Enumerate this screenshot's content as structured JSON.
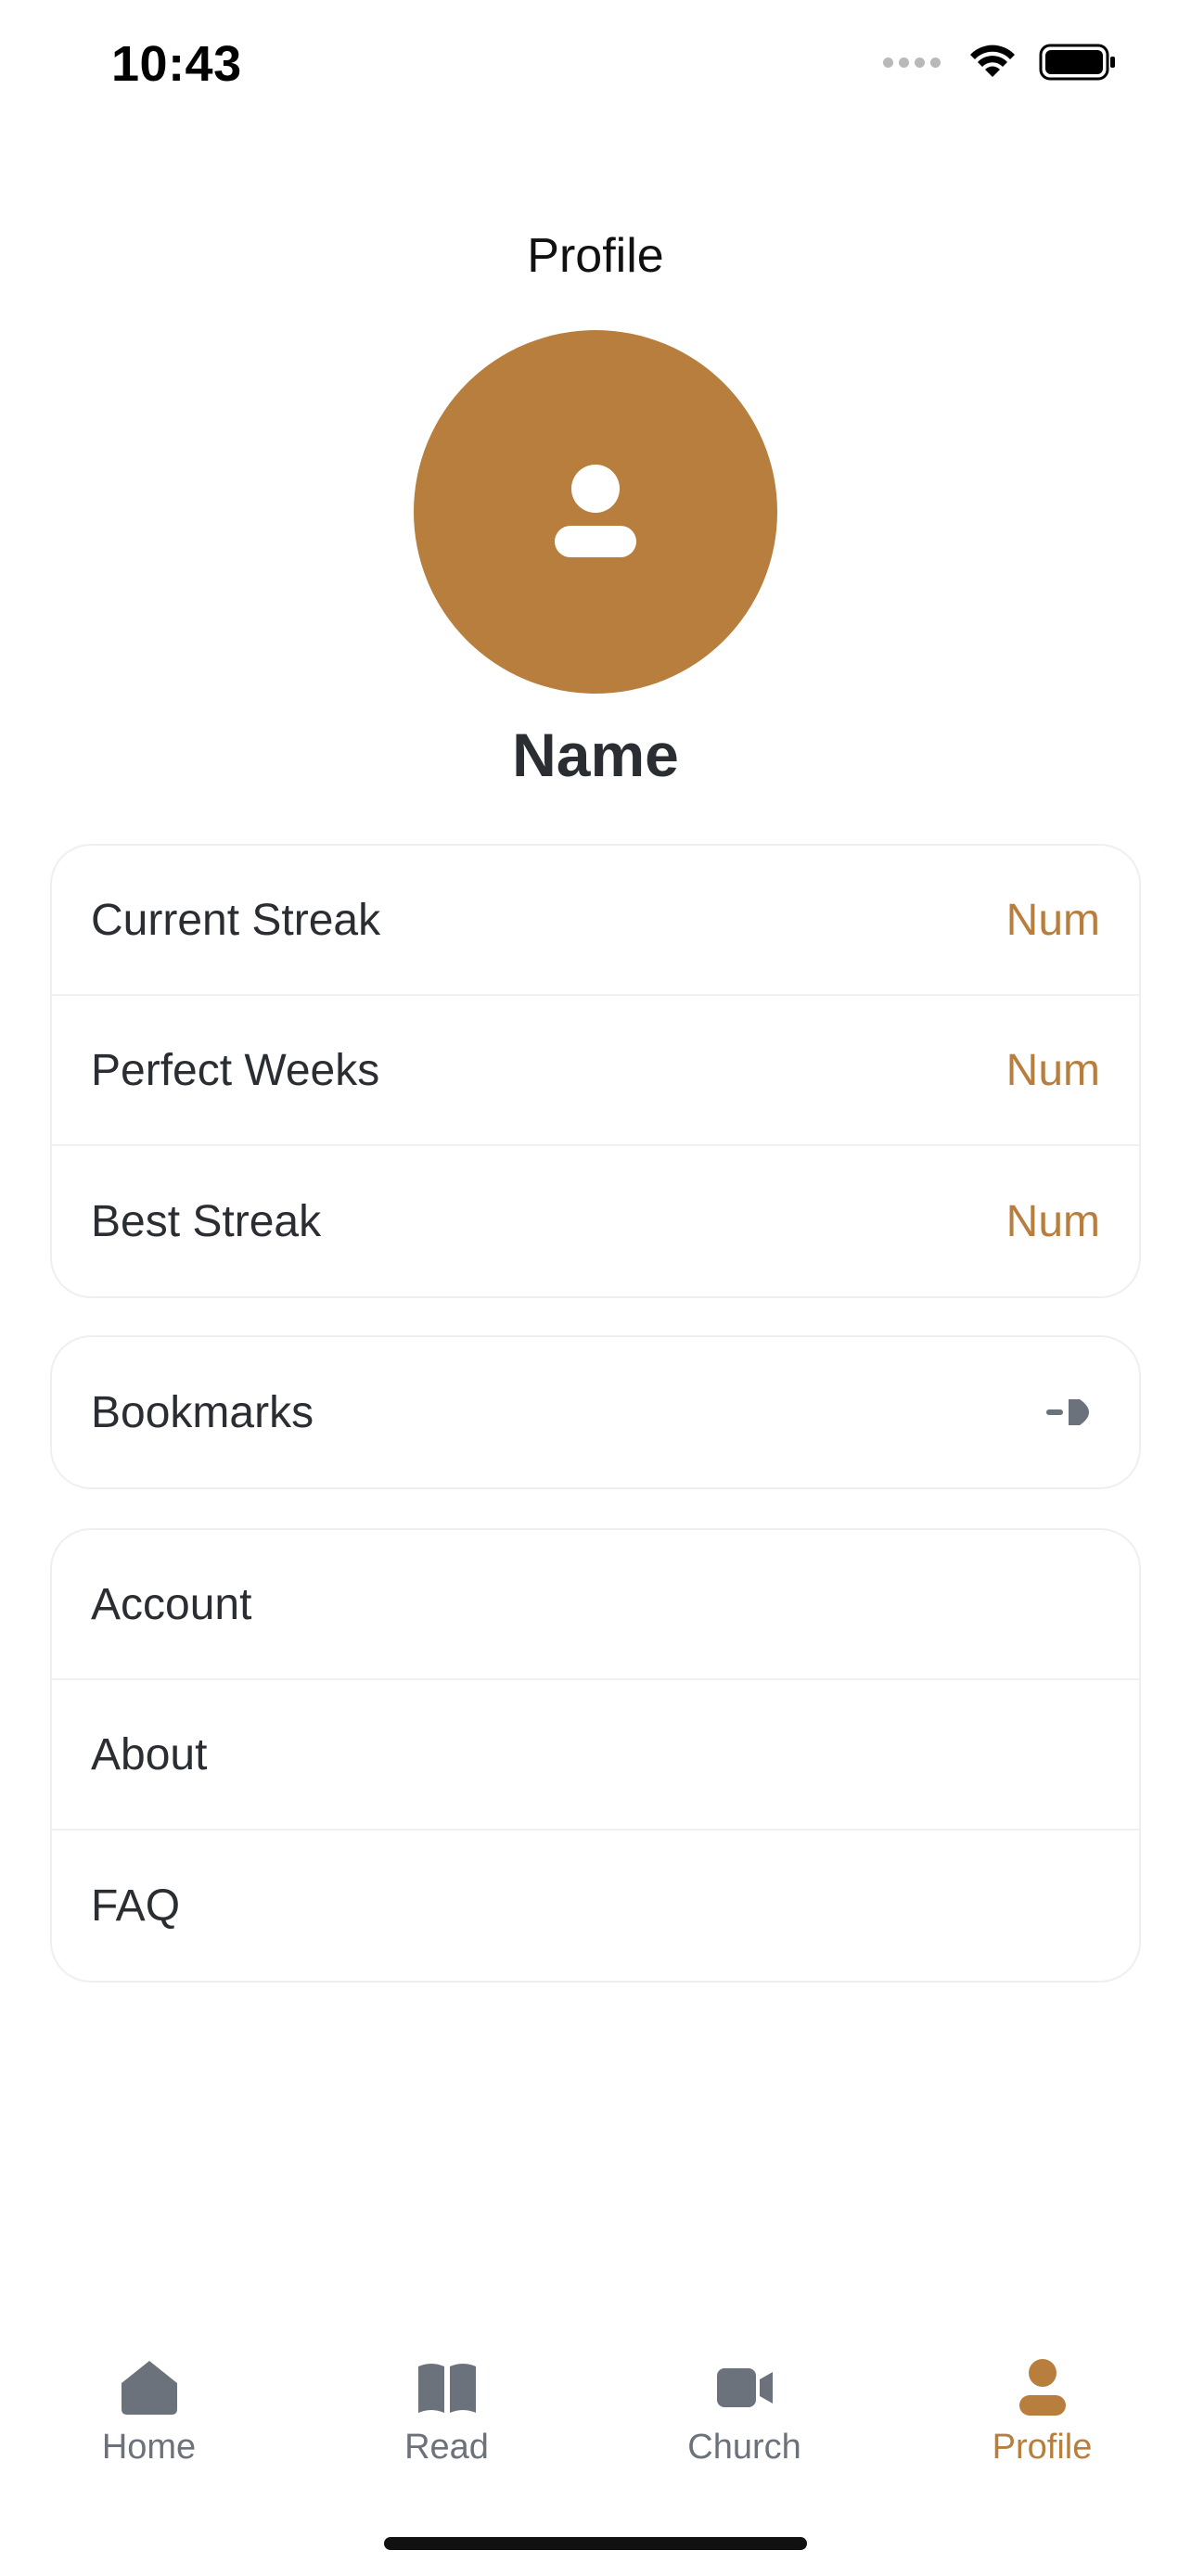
{
  "theme": {
    "accent": "#B87E3D",
    "text": "#2A2D31",
    "muted": "#6C727B",
    "divider": "#F1F1F1"
  },
  "status_bar": {
    "time": "10:43",
    "icons": [
      "cellular-signal-icon",
      "wifi-icon",
      "battery-icon"
    ]
  },
  "header": {
    "title": "Profile",
    "avatar_icon": "person-icon",
    "name": "Name"
  },
  "stats": [
    {
      "label": "Current Streak",
      "value": "Num"
    },
    {
      "label": "Perfect Weeks",
      "value": "Num"
    },
    {
      "label": "Best Streak",
      "value": "Num"
    }
  ],
  "bookmarks": {
    "label": "Bookmarks",
    "icon": "bookmark-arrow-icon"
  },
  "menu": [
    {
      "label": "Account"
    },
    {
      "label": "About"
    },
    {
      "label": "FAQ"
    }
  ],
  "tab_bar": {
    "tabs": [
      {
        "label": "Home",
        "icon": "home-icon",
        "active": false
      },
      {
        "label": "Read",
        "icon": "book-icon",
        "active": false
      },
      {
        "label": "Church",
        "icon": "video-camera-icon",
        "active": false
      },
      {
        "label": "Profile",
        "icon": "person-icon",
        "active": true
      }
    ]
  }
}
